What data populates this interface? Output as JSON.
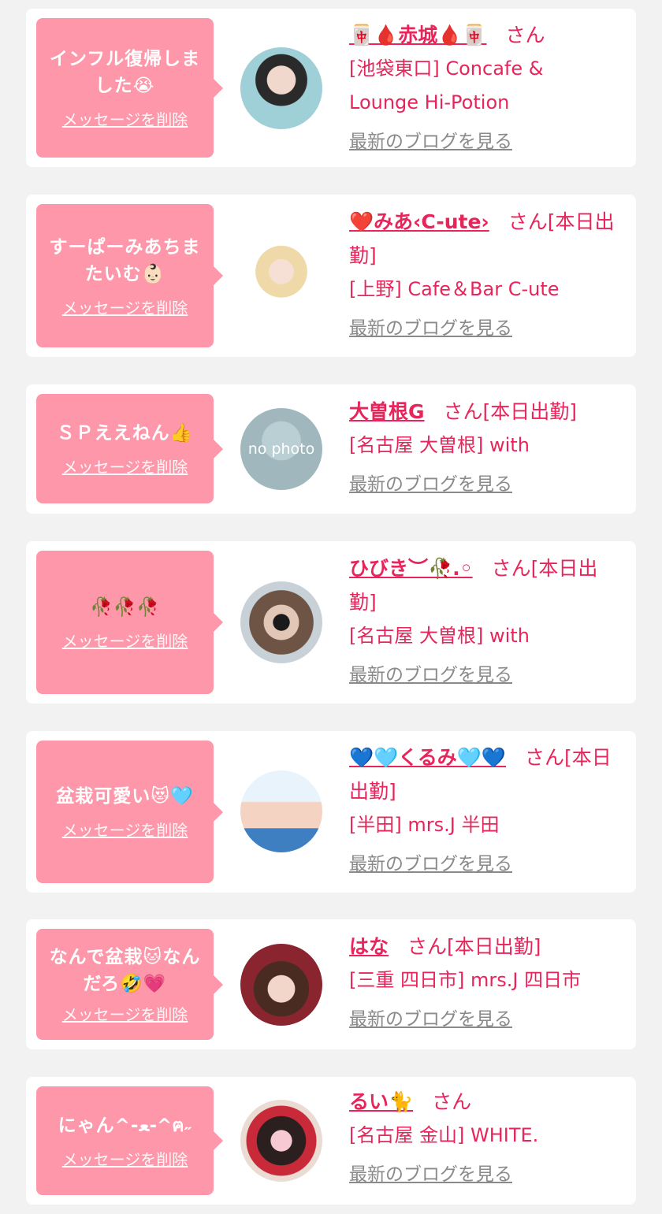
{
  "colors": {
    "accent": "#e8255b",
    "bubble": "#fd97a9",
    "link_gray": "#8a8a8a",
    "bg": "#f2f2f2"
  },
  "cards": [
    {
      "message": "インフル復帰しました😭",
      "delete_label": "メッセージを削除",
      "name": "🀄🩸赤城🩸🀄",
      "suffix": "さん",
      "shop": "[池袋東口] Concafe & Lounge Hi-Potion",
      "blog_label": "最新のブログを見る",
      "avatar": "photo"
    },
    {
      "message": "すーぱーみあちまたいむ👶🏻",
      "delete_label": "メッセージを削除",
      "name": "❤️みあ‹C-ute›",
      "suffix": "さん[本日出勤]",
      "shop": "[上野] Cafe＆Bar C-ute",
      "blog_label": "最新のブログを見る",
      "avatar": "photo"
    },
    {
      "message": "ＳＰええねん👍",
      "delete_label": "メッセージを削除",
      "name": "大曽根G",
      "suffix": "さん[本日出勤]",
      "shop": "[名古屋 大曽根] with",
      "blog_label": "最新のブログを見る",
      "avatar": "no photo"
    },
    {
      "message": "🥀🥀🥀",
      "delete_label": "メッセージを削除",
      "name": "ひびき︶🥀.◦",
      "suffix": "さん[本日出勤]",
      "shop": "[名古屋 大曽根] with",
      "blog_label": "最新のブログを見る",
      "avatar": "photo"
    },
    {
      "message": "盆栽可愛い😻🩵",
      "delete_label": "メッセージを削除",
      "name": "💙🩵くるみ🩵💙",
      "suffix": "さん[本日出勤]",
      "shop": "[半田] mrs.J 半田",
      "blog_label": "最新のブログを見る",
      "avatar": "photo"
    },
    {
      "message": "なんで盆栽🐱なんだろ🤣💗",
      "delete_label": "メッセージを削除",
      "name": "はな",
      "suffix": "さん[本日出勤]",
      "shop": "[三重 四日市] mrs.J 四日市",
      "blog_label": "最新のブログを見る",
      "avatar": "photo"
    },
    {
      "message": "にゃん^-ﻌ-^ฅ˶",
      "delete_label": "メッセージを削除",
      "name": "るい🐈",
      "suffix": "さん",
      "shop": "[名古屋 金山] WHITE.",
      "blog_label": "最新のブログを見る",
      "avatar": "photo"
    }
  ]
}
